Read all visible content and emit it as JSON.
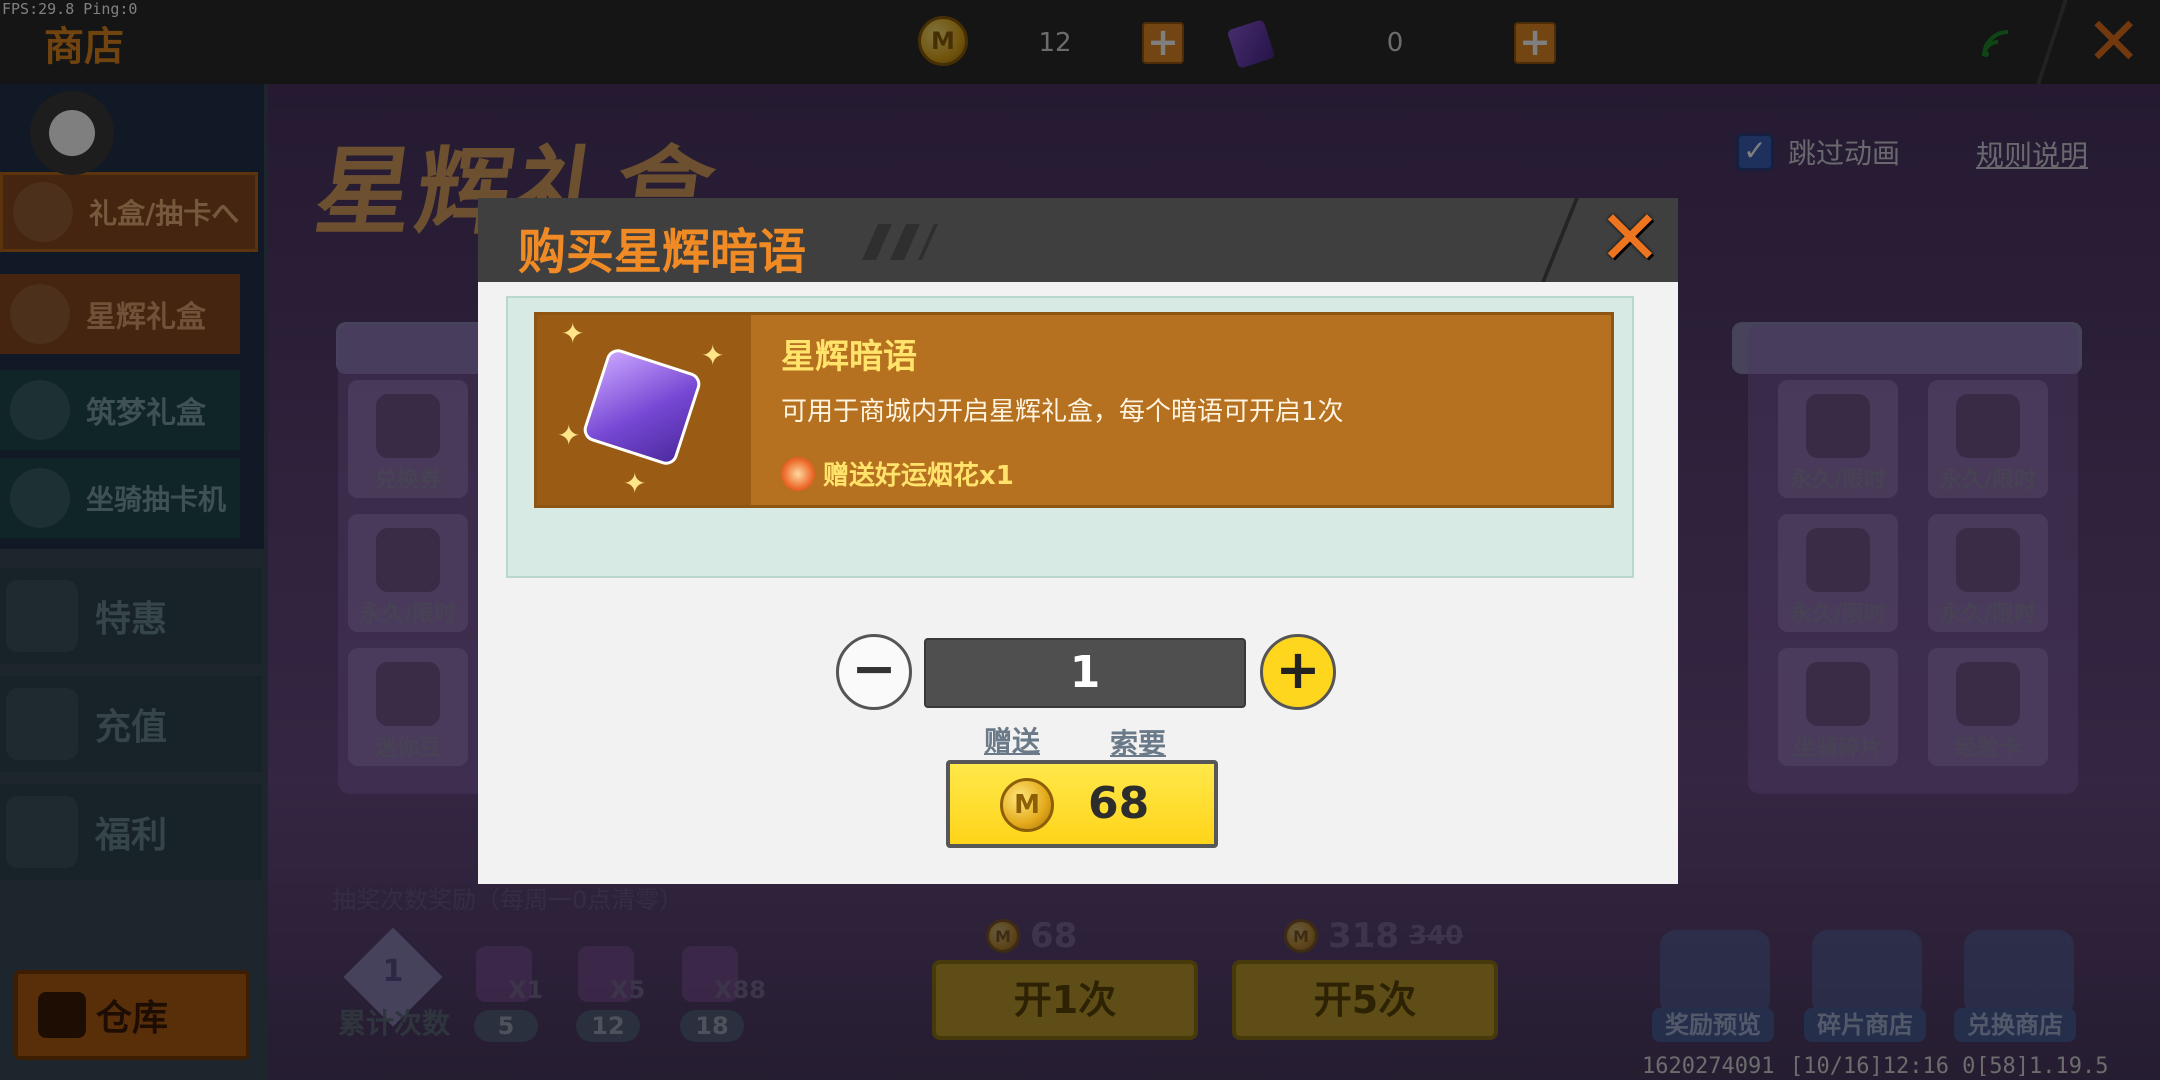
{
  "debug": {
    "fps_text": "FPS:29.8  Ping:0"
  },
  "topbar": {
    "title": "商店",
    "coin_icon": "M",
    "coins": "12",
    "tickets": "0",
    "plus": "+",
    "close": "✕"
  },
  "sidebar": {
    "items": [
      {
        "label": "礼盒/抽卡へ"
      },
      {
        "label": "星辉礼盒"
      },
      {
        "label": "筑梦礼盒"
      },
      {
        "label": "坐骑抽卡机"
      }
    ],
    "special": "特惠",
    "recharge": "充值",
    "welfare": "福利",
    "warehouse": "仓库"
  },
  "main": {
    "title": "星辉礼盒",
    "skip_animation": "跳过动画",
    "rules": "规则说明",
    "left_cells": [
      "兑换券",
      "永久/限时",
      "迷你豆"
    ],
    "right_cells": [
      "永久/限时",
      "永久/限时",
      "永久/限时",
      "永久/限时",
      "坐骑碎片",
      "经验卡"
    ],
    "draw_note": "抽奖次数奖励（每周一0点清零）",
    "cumulative_label": "累计次数",
    "milestone_start": "1",
    "milestones": [
      {
        "mult": "X1",
        "count": "5"
      },
      {
        "mult": "X5",
        "count": "12"
      },
      {
        "mult": "X88",
        "count": "18"
      }
    ],
    "open1_price": "68",
    "open1_label": "开1次",
    "open5_price": "318",
    "open5_original": "340",
    "open5_label": "开5次",
    "bottom_buttons": [
      "奖励预览",
      "碎片商店",
      "兑换商店"
    ],
    "footer": [
      "1620274091",
      "[10/16]12:16 0",
      "[58]1.19.5"
    ]
  },
  "dialog": {
    "title": "购买星辉暗语",
    "close": "✕",
    "item": {
      "name": "星辉暗语",
      "description": "可用于商城内开启星辉礼盒，每个暗语可开启1次",
      "bonus": "赠送好运烟花x1"
    },
    "quantity": "1",
    "minus": "−",
    "plus": "+",
    "gift_link": "赠送",
    "ask_link": "索要",
    "price": "68",
    "coin_icon": "M"
  },
  "colors": {
    "accent_orange": "#f08a24",
    "buy_yellow": "#ffd61e",
    "item_card": "#b5711f",
    "panel_bg": "#d7ebe4"
  },
  "icons": {
    "coin": "coin-icon",
    "ticket": "ticket-icon",
    "signal": "signal-icon",
    "close": "close-icon",
    "firework": "firework-icon",
    "item": "star-whisper-card-icon"
  }
}
